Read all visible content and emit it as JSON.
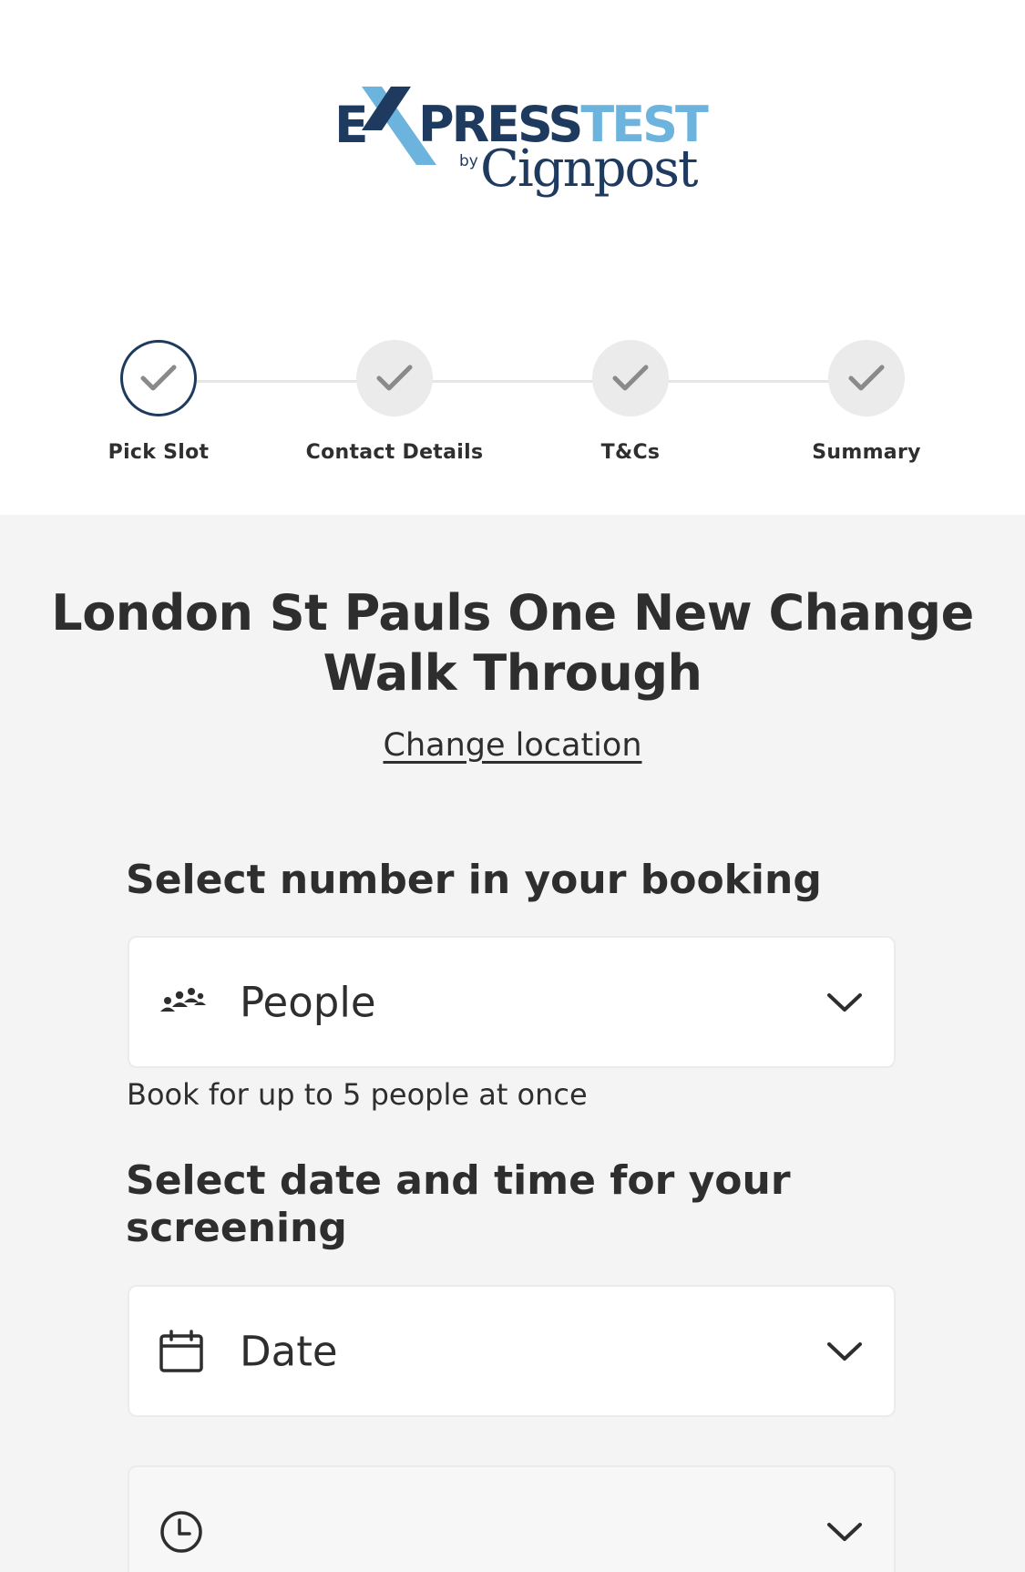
{
  "brand": {
    "logo_text_e": "E",
    "logo_text_press": "PRESS",
    "logo_text_test": "TEST",
    "logo_text_by": "by",
    "logo_text_cignpost": "Cignpost",
    "colors": {
      "navy": "#1e3a5f",
      "light_blue": "#6cb3dd"
    }
  },
  "stepper": {
    "steps": [
      {
        "label": "Pick Slot",
        "state": "active",
        "icon": "check-icon"
      },
      {
        "label": "Contact Details",
        "state": "pending",
        "icon": "check-icon"
      },
      {
        "label": "T&Cs",
        "state": "pending",
        "icon": "check-icon"
      },
      {
        "label": "Summary",
        "state": "pending",
        "icon": "check-icon"
      }
    ]
  },
  "location": {
    "title": "London St Pauls One New Change Walk Through",
    "change_link": "Change location"
  },
  "booking": {
    "heading": "Select number in your booking",
    "people_dropdown": {
      "value": "People",
      "icon": "people-icon"
    },
    "helper_text": "Book for up to 5 people at once"
  },
  "screening": {
    "heading": "Select date and time for your screening",
    "date_dropdown": {
      "value": "Date",
      "icon": "calendar-icon"
    },
    "time_dropdown": {
      "value": "",
      "icon": "clock-icon"
    }
  }
}
